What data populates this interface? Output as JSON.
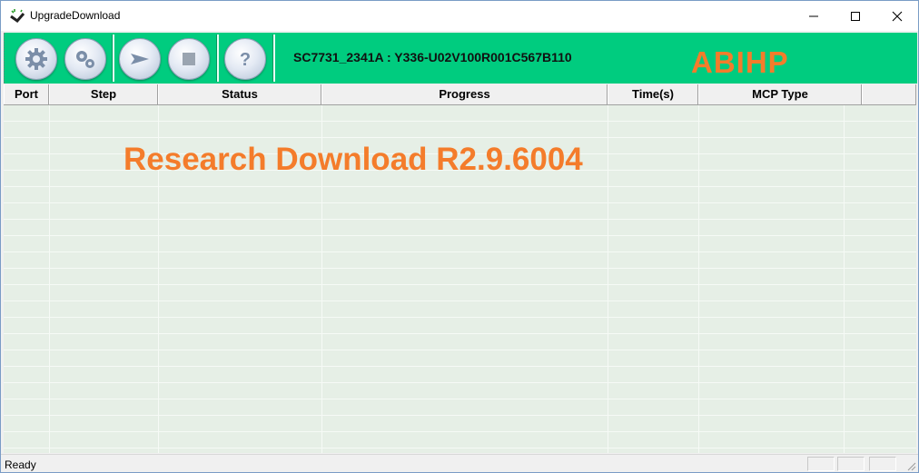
{
  "window": {
    "title": "UpgradeDownload"
  },
  "toolbar": {
    "buttons": [
      {
        "icon": "gear-icon"
      },
      {
        "icon": "gears-icon"
      },
      {
        "icon": "play-arrow-icon"
      },
      {
        "icon": "stop-icon"
      },
      {
        "icon": "help-icon"
      }
    ],
    "firmware_label": "SC7731_2341A : Y336-U02V100R001C567B110",
    "brand_text": "ABIHP",
    "background_color": "#00cc7f"
  },
  "table": {
    "columns": [
      "Port",
      "Step",
      "Status",
      "Progress",
      "Time(s)",
      "MCP Type",
      ""
    ],
    "rows": []
  },
  "watermark": "Research Download R2.9.6004",
  "statusbar": {
    "text": "Ready"
  },
  "colors": {
    "accent_text": "#f47c2b",
    "grid_background": "#e6efe6"
  }
}
